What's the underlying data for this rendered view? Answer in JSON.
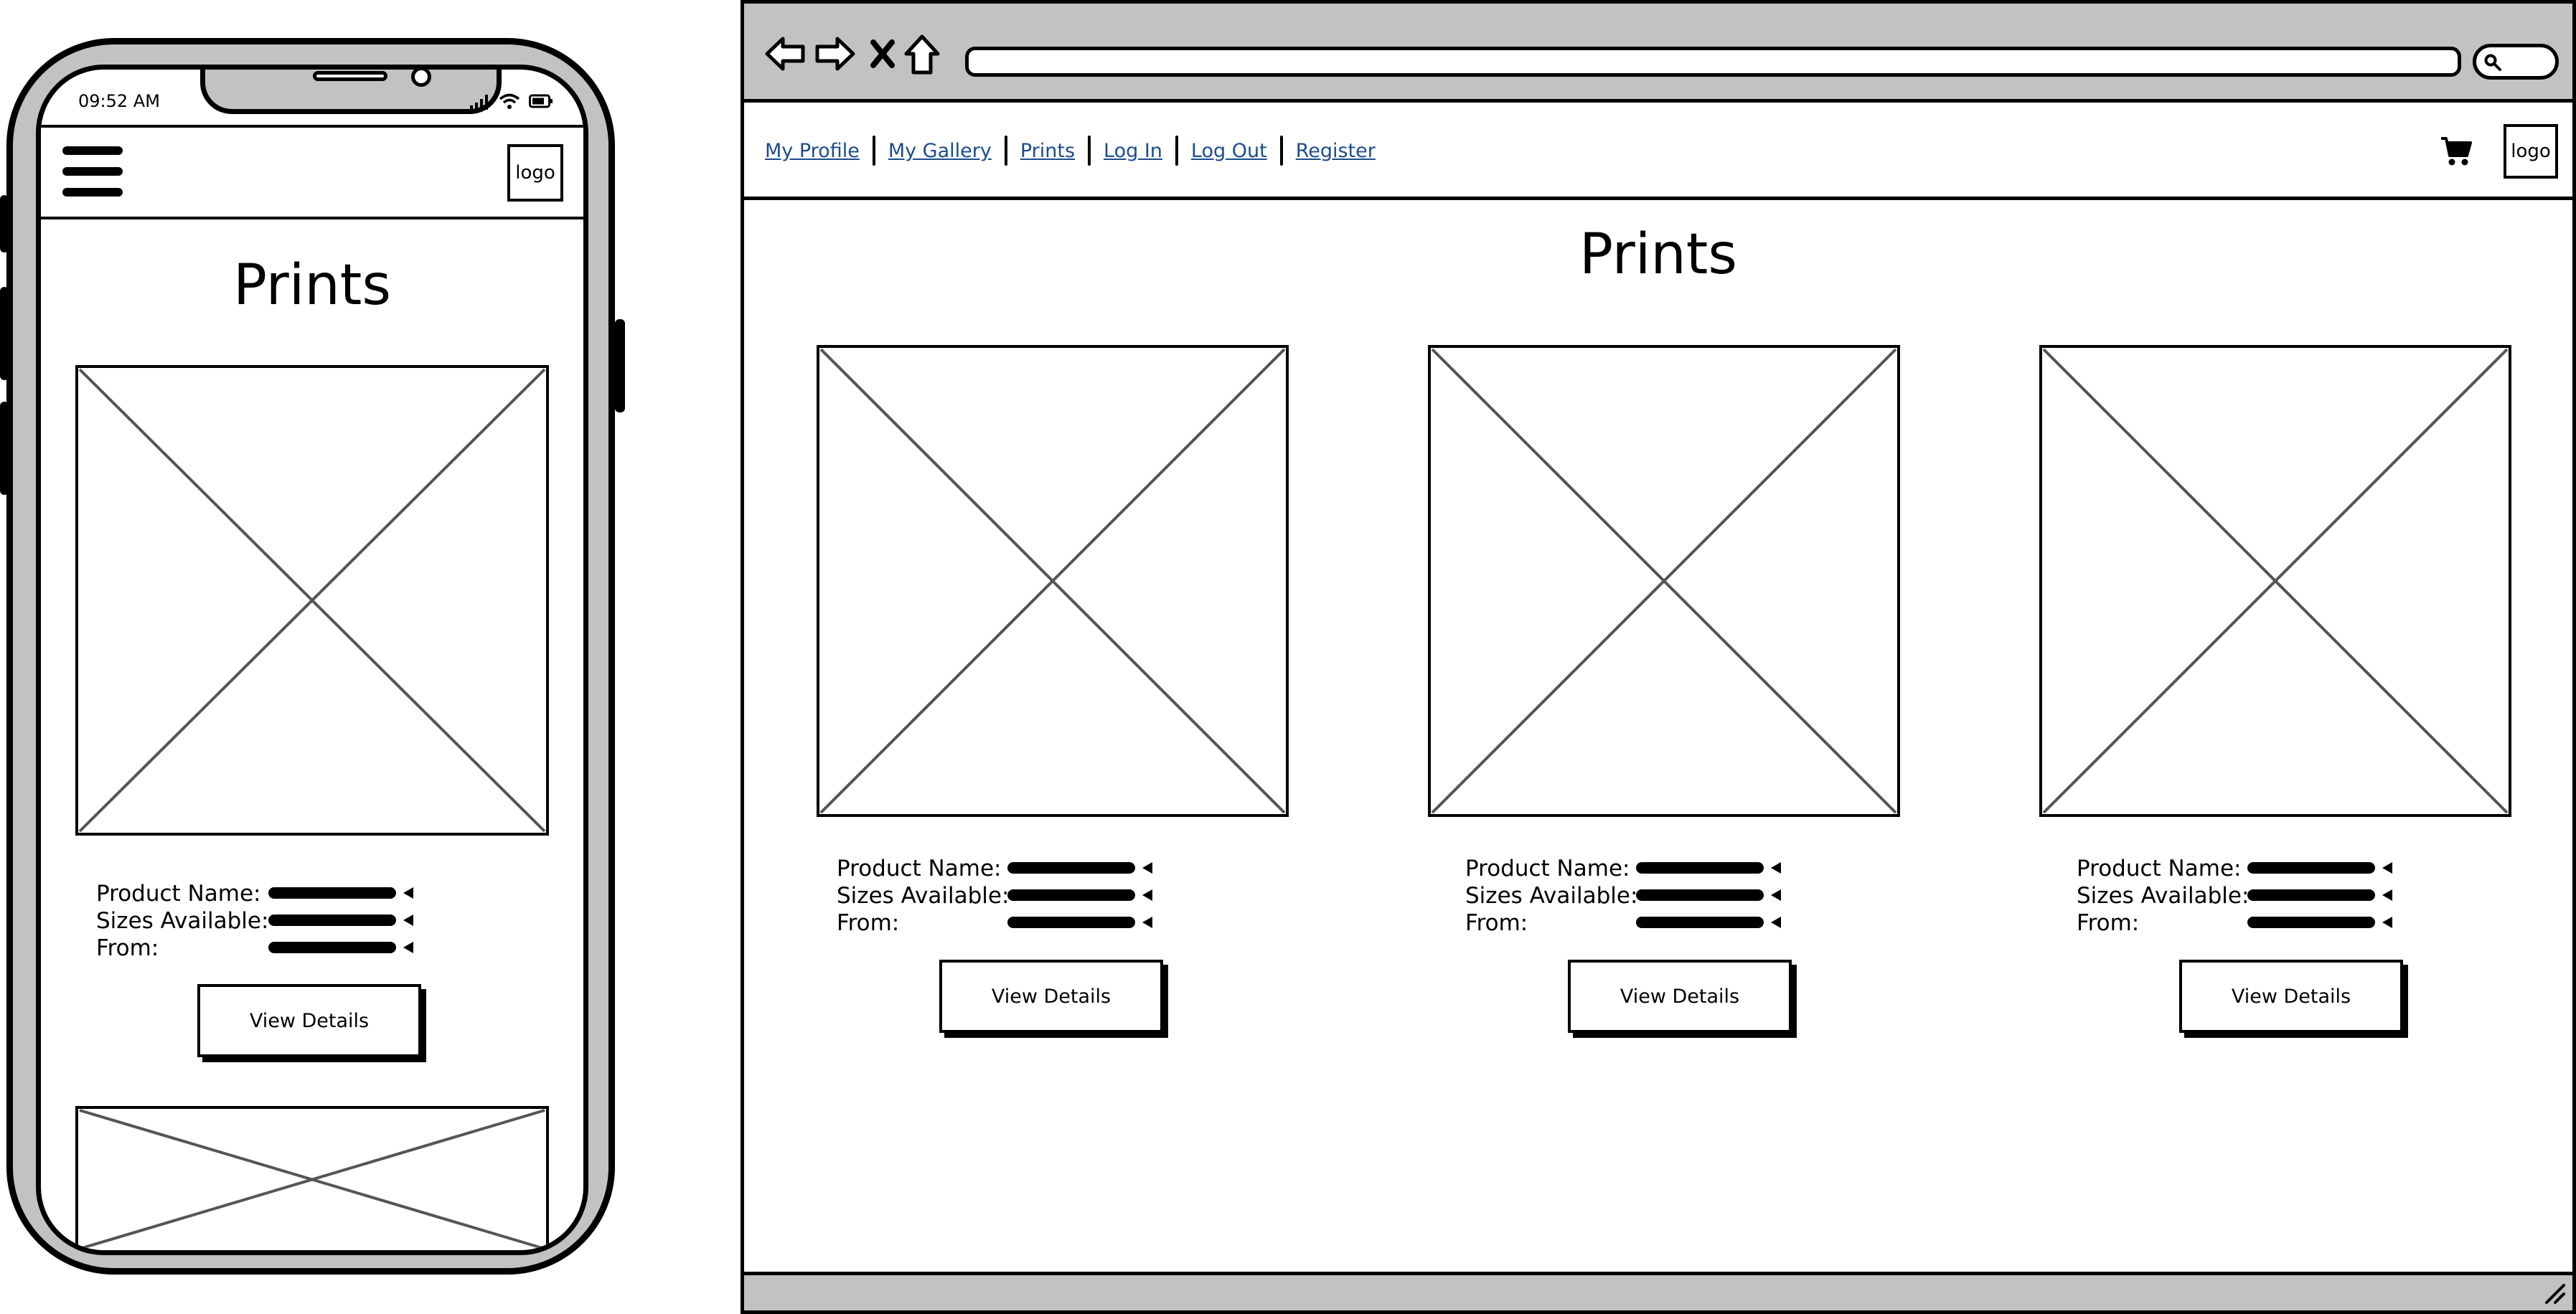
{
  "phone": {
    "status_time": "09:52 AM",
    "logo_label": "logo",
    "page_title": "Prints",
    "product": {
      "name_label": "Product Name:",
      "sizes_label": "Sizes Available:",
      "from_label": "From:",
      "button_label": "View Details"
    }
  },
  "browser": {
    "nav_links": [
      "My Profile",
      "My Gallery",
      "Prints",
      "Log In",
      "Log Out",
      "Register"
    ],
    "logo_label": "logo",
    "page_title": "Prints",
    "products": [
      {
        "name_label": "Product Name:",
        "sizes_label": "Sizes Available:",
        "from_label": "From:",
        "button_label": "View Details"
      },
      {
        "name_label": "Product Name:",
        "sizes_label": "Sizes Available:",
        "from_label": "From:",
        "button_label": "View Details"
      },
      {
        "name_label": "Product Name:",
        "sizes_label": "Sizes Available:",
        "from_label": "From:",
        "button_label": "View Details"
      }
    ]
  },
  "icons": {
    "nav_back": "back-arrow-icon",
    "nav_forward": "forward-arrow-icon",
    "nav_stop": "close-icon",
    "nav_home": "home-icon",
    "search": "search-icon",
    "cart": "cart-icon",
    "menu": "hamburger-menu-icon",
    "image_placeholder": "image-placeholder-icon",
    "signal": "signal-icon",
    "wifi": "wifi-icon",
    "battery": "battery-icon",
    "resize": "resize-grip-icon"
  },
  "colors": {
    "frame_gray": "#c2c2c2",
    "link_blue": "#1c4d8a"
  }
}
